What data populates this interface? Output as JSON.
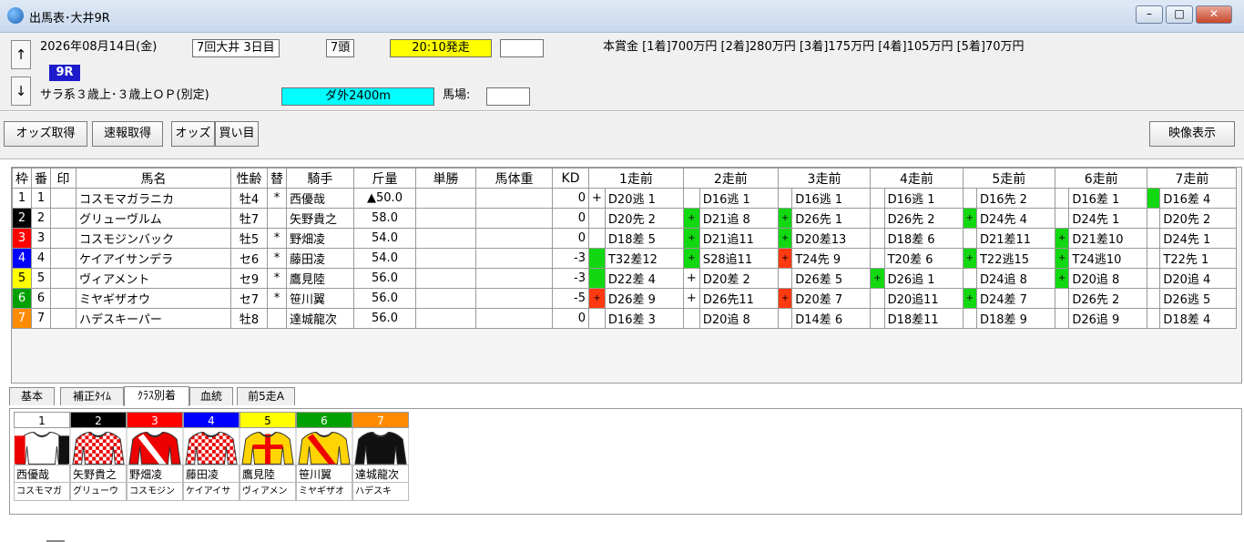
{
  "window": {
    "title": "出馬表･大井9R",
    "min": "–",
    "max": "□",
    "close": "✕"
  },
  "race": {
    "date": "2026年08月14日(金)",
    "meeting": "7回大井 3日目",
    "heads": "7頭",
    "start": "20:10発走",
    "blank": "",
    "race_no": "9R",
    "class": "サラ系３歳上･３歳上ＯＰ(別定)",
    "course": "ダ外2400m",
    "track_label": "馬場:",
    "track_value": "",
    "prize": "本賞金 [1着]700万円 [2着]280万円 [3着]175万円 [4着]105万円 [5着]70万円",
    "up": "↑",
    "down": "↓"
  },
  "toolbar": {
    "odds_get": "オッズ取得",
    "sokuhou": "速報取得",
    "odds": "オッズ",
    "kaime": "買い目",
    "video": "映像表示"
  },
  "table": {
    "headers": [
      "枠",
      "番",
      "印",
      "馬名",
      "性齢",
      "替",
      "騎手",
      "斤量",
      "単勝",
      "馬体重",
      "KD",
      "1走前",
      "2走前",
      "3走前",
      "4走前",
      "5走前",
      "6走前",
      "7走前"
    ],
    "rows": [
      {
        "waku": "1",
        "ban": "1",
        "mark": "",
        "name": "コスモマガラニカ",
        "sexage": "牡4",
        "sub": "*",
        "jockey": "西優哉",
        "kin": "▲50.0",
        "tan": "",
        "weight": "",
        "kd": "0",
        "f": [
          "",
          "",
          "",
          "",
          "",
          ""
        ],
        "p": [
          "D20逃 1",
          "D16逃 1",
          "D16逃 1",
          "D16逃 1",
          "D16先 2",
          "D16差 1",
          "D16差 4"
        ],
        "f7": "+"
      },
      {
        "waku": "2",
        "ban": "2",
        "mark": "",
        "name": "グリューヴルム",
        "sexage": "牡7",
        "sub": "",
        "jockey": "矢野貴之",
        "kin": "58.0",
        "tan": "",
        "weight": "",
        "kd": "0",
        "f": [
          "+",
          "+",
          "",
          "+",
          "",
          ""
        ],
        "p": [
          "D20先 2",
          "D21追 8",
          "D26先 1",
          "D26先 2",
          "D24先 4",
          "D24先 1",
          "D20先 2"
        ],
        "f7": ""
      },
      {
        "waku": "3",
        "ban": "3",
        "mark": "",
        "name": "コスモジンバック",
        "sexage": "牡5",
        "sub": "*",
        "jockey": "野畑凌",
        "kin": "54.0",
        "tan": "",
        "weight": "",
        "kd": "0",
        "f": [
          "+",
          "+",
          "",
          "",
          "+",
          ""
        ],
        "p": [
          "D18差 5",
          "D21追11",
          "D20差13",
          "D18差 6",
          "D21差11",
          "D21差10",
          "D24先 1"
        ],
        "f7": ""
      },
      {
        "waku": "4",
        "ban": "4",
        "mark": "",
        "name": "ケイアイサンデラ",
        "sexage": "セ6",
        "sub": "*",
        "jockey": "藤田凌",
        "kin": "54.0",
        "tan": "",
        "weight": "",
        "kd": "-3",
        "f": [
          "+",
          "+",
          "",
          "+",
          "+",
          ""
        ],
        "p": [
          "T32差12",
          "S28追11",
          "T24先 9",
          "T20差 6",
          "T22逃15",
          "T24逃10",
          "T22先 1"
        ],
        "f7": ""
      },
      {
        "waku": "5",
        "ban": "5",
        "mark": "",
        "name": "ヴィアメント",
        "sexage": "セ9",
        "sub": "*",
        "jockey": "鷹見陸",
        "kin": "56.0",
        "tan": "",
        "weight": "",
        "kd": "-3",
        "f": [
          "+",
          "",
          "+",
          "",
          "+",
          ""
        ],
        "p": [
          "D22差 4",
          "D20差 2",
          "D26差 5",
          "D26追 1",
          "D24追 8",
          "D20追 8",
          "D20追 4"
        ],
        "f7": ""
      },
      {
        "waku": "6",
        "ban": "6",
        "mark": "",
        "name": "ミヤギザオウ",
        "sexage": "セ7",
        "sub": "*",
        "jockey": "笹川翼",
        "kin": "56.0",
        "tan": "",
        "weight": "",
        "kd": "-5",
        "f": [
          "+",
          "+",
          "",
          "+",
          "",
          ""
        ],
        "p": [
          "D26差 9",
          "D26先11",
          "D20差 7",
          "D20追11",
          "D24差 7",
          "D26先 2",
          "D26逃 5"
        ],
        "f7": "+"
      },
      {
        "waku": "7",
        "ban": "7",
        "mark": "",
        "name": "ハデスキーパー",
        "sexage": "牡8",
        "sub": "",
        "jockey": "達城龍次",
        "kin": "56.0",
        "tan": "",
        "weight": "",
        "kd": "0",
        "f": [
          "",
          "",
          "",
          "",
          "",
          ""
        ],
        "p": [
          "D16差 3",
          "D20追 8",
          "D14差 6",
          "D18差11",
          "D18差 9",
          "D26追 9",
          "D18差 4"
        ],
        "f7": ""
      }
    ]
  },
  "flag_colors": {
    "r1": [
      "n",
      "n",
      "n",
      "n",
      "n",
      "n",
      "g"
    ],
    "r2": [
      "n",
      "g",
      "g",
      "n",
      "g",
      "n",
      "n"
    ],
    "r3": [
      "n",
      "g",
      "g",
      "n",
      "n",
      "g",
      "n"
    ],
    "r4": [
      "g",
      "g",
      "o",
      "n",
      "g",
      "g",
      "n"
    ],
    "r5": [
      "g",
      "n",
      "n",
      "g",
      "n",
      "g",
      "n"
    ],
    "r6": [
      "o",
      "n",
      "o",
      "n",
      "g",
      "n",
      "n"
    ],
    "r7": [
      "n",
      "n",
      "n",
      "n",
      "n",
      "n",
      "n"
    ]
  },
  "waku_colors": [
    "#ffffff",
    "#000000",
    "#ff0000",
    "#0000ff",
    "#ffff00",
    "#00a000",
    "#ff8c00"
  ],
  "waku_text_colors": [
    "#000000",
    "#ffffff",
    "#ffffff",
    "#ffffff",
    "#000000",
    "#ffffff",
    "#ffffff"
  ],
  "tabs": [
    "基本",
    "補正ﾀｲﾑ",
    "ｸﾗｽ別着",
    "血統",
    "前5走A"
  ],
  "silks": [
    {
      "num": "1",
      "jockey": "西優哉",
      "horse": "コスモマガ"
    },
    {
      "num": "2",
      "jockey": "矢野貴之",
      "horse": "グリューウ"
    },
    {
      "num": "3",
      "jockey": "野畑凌",
      "horse": "コスモジン"
    },
    {
      "num": "4",
      "jockey": "藤田凌",
      "horse": "ケイアイサ"
    },
    {
      "num": "5",
      "jockey": "鷹見陸",
      "horse": "ヴィアメン"
    },
    {
      "num": "6",
      "jockey": "笹川翼",
      "horse": "ミヤギザオ"
    },
    {
      "num": "7",
      "jockey": "達城龍次",
      "horse": "ハデスキ"
    }
  ]
}
